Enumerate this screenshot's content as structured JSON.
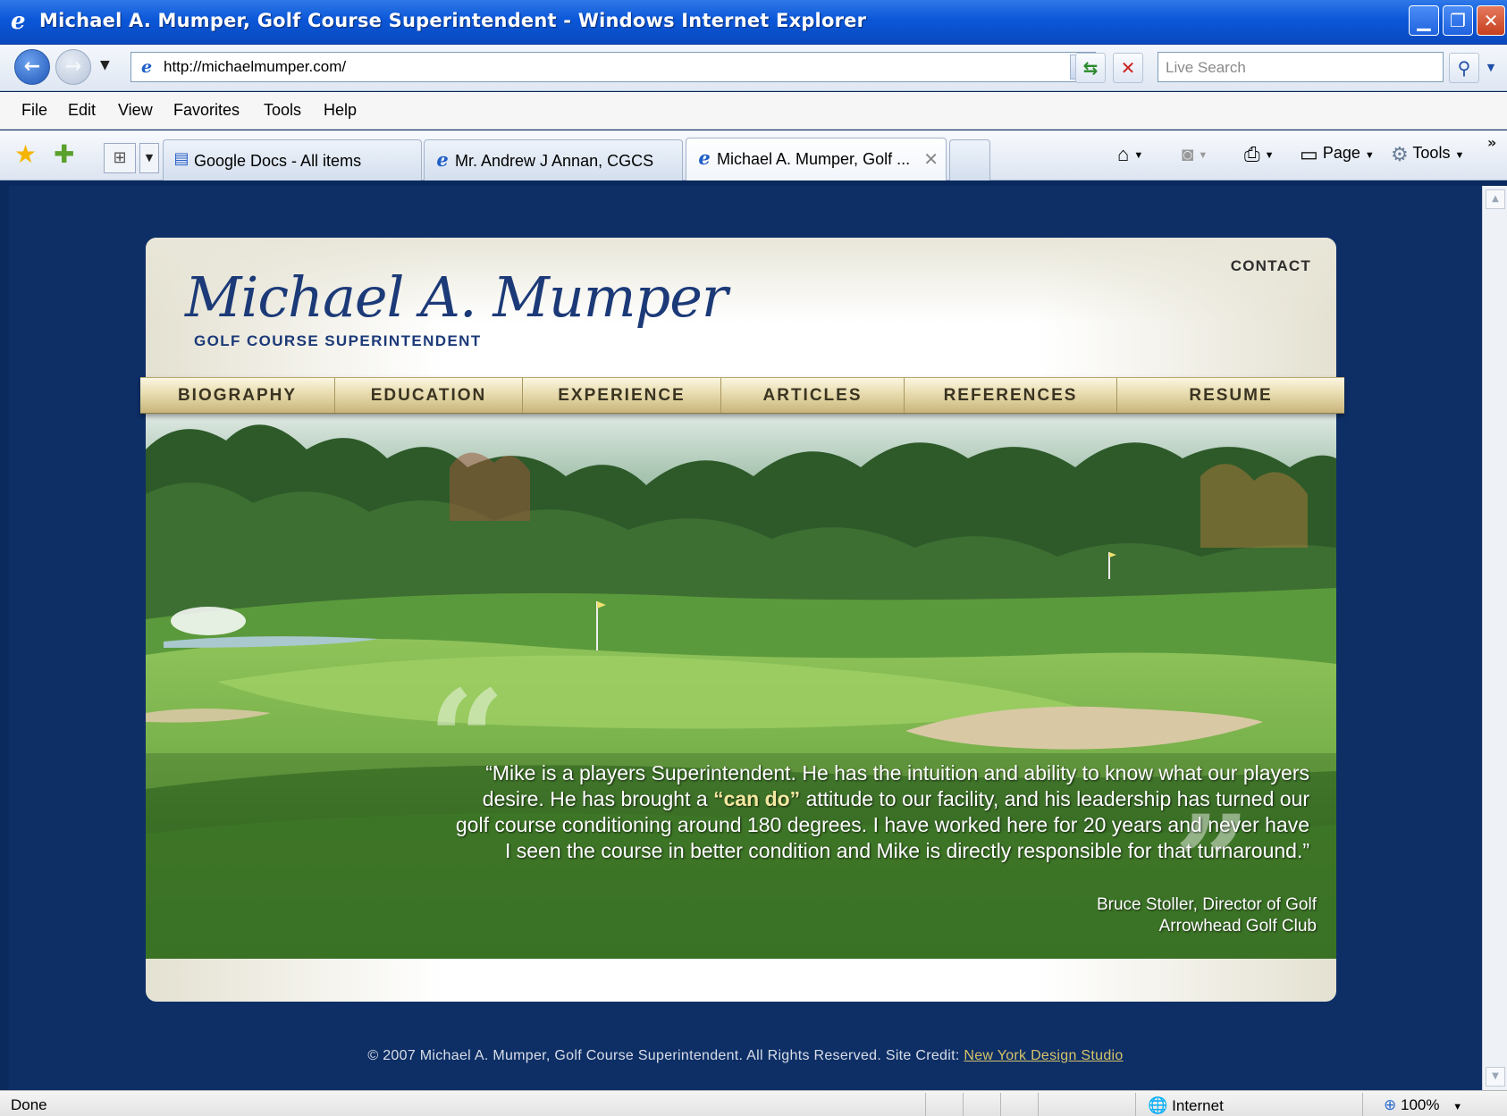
{
  "window": {
    "title": "Michael A. Mumper, Golf Course Superintendent - Windows Internet Explorer",
    "min_glyph": "▁",
    "max_glyph": "❐",
    "close_glyph": "✕"
  },
  "address_bar": {
    "url": "http://michaelmumper.com/",
    "search_placeholder": "Live Search"
  },
  "menu": [
    "File",
    "Edit",
    "View",
    "Favorites",
    "Tools",
    "Help"
  ],
  "tabs": [
    {
      "label": "Google Docs - All items",
      "icon": "document-icon"
    },
    {
      "label": "Mr. Andrew J Annan, CGCS",
      "icon": "ie-page-icon"
    },
    {
      "label": "Michael A. Mumper, Golf ...",
      "icon": "ie-page-icon",
      "active": true
    }
  ],
  "command_bar": {
    "page_label": "Page",
    "tools_label": "Tools"
  },
  "site": {
    "logo_script": "Michael A. Mumper",
    "logo_subtitle": "GOLF COURSE SUPERINTENDENT",
    "contact": "CONTACT",
    "nav": [
      "BIOGRAPHY",
      "EDUCATION",
      "EXPERIENCE",
      "ARTICLES",
      "REFERENCES",
      "RESUME"
    ],
    "quote": {
      "part1": "“Mike is a players Superintendent. He has the intuition and ability to know what our players desire. He has brought a ",
      "emphasis": "“can do”",
      "part2": " attitude to our facility, and his leadership has turned our golf course conditioning around 180 degrees. I have worked here for 20 years and never have I seen the course in better condition and Mike is directly responsible for that turnaround.”"
    },
    "attribution": {
      "name": "Bruce Stoller, Director of Golf",
      "club": "Arrowhead Golf Club"
    },
    "footer": {
      "text": "© 2007 Michael A. Mumper, Golf Course Superintendent. All Rights Reserved. Site Credit: ",
      "credit_link": "New York Design Studio"
    }
  },
  "status_bar": {
    "status": "Done",
    "zone": "Internet",
    "zoom": "100%"
  },
  "colors": {
    "page_background": "#0e2f66",
    "brand_blue": "#1c3a78",
    "nav_gold": "#e8dcaf",
    "credit_link": "#d6c36a"
  }
}
